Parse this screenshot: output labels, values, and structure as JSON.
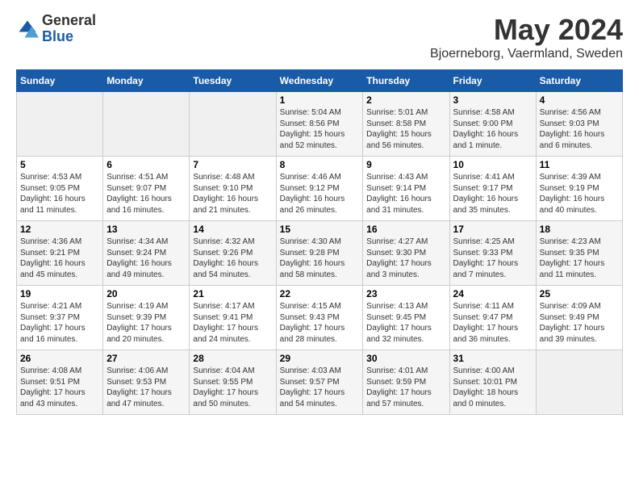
{
  "header": {
    "logo_general": "General",
    "logo_blue": "Blue",
    "title": "May 2024",
    "location": "Bjoerneborg, Vaermland, Sweden"
  },
  "weekdays": [
    "Sunday",
    "Monday",
    "Tuesday",
    "Wednesday",
    "Thursday",
    "Friday",
    "Saturday"
  ],
  "weeks": [
    [
      {
        "day": "",
        "info": ""
      },
      {
        "day": "",
        "info": ""
      },
      {
        "day": "",
        "info": ""
      },
      {
        "day": "1",
        "info": "Sunrise: 5:04 AM\nSunset: 8:56 PM\nDaylight: 15 hours and 52 minutes."
      },
      {
        "day": "2",
        "info": "Sunrise: 5:01 AM\nSunset: 8:58 PM\nDaylight: 15 hours and 56 minutes."
      },
      {
        "day": "3",
        "info": "Sunrise: 4:58 AM\nSunset: 9:00 PM\nDaylight: 16 hours and 1 minute."
      },
      {
        "day": "4",
        "info": "Sunrise: 4:56 AM\nSunset: 9:03 PM\nDaylight: 16 hours and 6 minutes."
      }
    ],
    [
      {
        "day": "5",
        "info": "Sunrise: 4:53 AM\nSunset: 9:05 PM\nDaylight: 16 hours and 11 minutes."
      },
      {
        "day": "6",
        "info": "Sunrise: 4:51 AM\nSunset: 9:07 PM\nDaylight: 16 hours and 16 minutes."
      },
      {
        "day": "7",
        "info": "Sunrise: 4:48 AM\nSunset: 9:10 PM\nDaylight: 16 hours and 21 minutes."
      },
      {
        "day": "8",
        "info": "Sunrise: 4:46 AM\nSunset: 9:12 PM\nDaylight: 16 hours and 26 minutes."
      },
      {
        "day": "9",
        "info": "Sunrise: 4:43 AM\nSunset: 9:14 PM\nDaylight: 16 hours and 31 minutes."
      },
      {
        "day": "10",
        "info": "Sunrise: 4:41 AM\nSunset: 9:17 PM\nDaylight: 16 hours and 35 minutes."
      },
      {
        "day": "11",
        "info": "Sunrise: 4:39 AM\nSunset: 9:19 PM\nDaylight: 16 hours and 40 minutes."
      }
    ],
    [
      {
        "day": "12",
        "info": "Sunrise: 4:36 AM\nSunset: 9:21 PM\nDaylight: 16 hours and 45 minutes."
      },
      {
        "day": "13",
        "info": "Sunrise: 4:34 AM\nSunset: 9:24 PM\nDaylight: 16 hours and 49 minutes."
      },
      {
        "day": "14",
        "info": "Sunrise: 4:32 AM\nSunset: 9:26 PM\nDaylight: 16 hours and 54 minutes."
      },
      {
        "day": "15",
        "info": "Sunrise: 4:30 AM\nSunset: 9:28 PM\nDaylight: 16 hours and 58 minutes."
      },
      {
        "day": "16",
        "info": "Sunrise: 4:27 AM\nSunset: 9:30 PM\nDaylight: 17 hours and 3 minutes."
      },
      {
        "day": "17",
        "info": "Sunrise: 4:25 AM\nSunset: 9:33 PM\nDaylight: 17 hours and 7 minutes."
      },
      {
        "day": "18",
        "info": "Sunrise: 4:23 AM\nSunset: 9:35 PM\nDaylight: 17 hours and 11 minutes."
      }
    ],
    [
      {
        "day": "19",
        "info": "Sunrise: 4:21 AM\nSunset: 9:37 PM\nDaylight: 17 hours and 16 minutes."
      },
      {
        "day": "20",
        "info": "Sunrise: 4:19 AM\nSunset: 9:39 PM\nDaylight: 17 hours and 20 minutes."
      },
      {
        "day": "21",
        "info": "Sunrise: 4:17 AM\nSunset: 9:41 PM\nDaylight: 17 hours and 24 minutes."
      },
      {
        "day": "22",
        "info": "Sunrise: 4:15 AM\nSunset: 9:43 PM\nDaylight: 17 hours and 28 minutes."
      },
      {
        "day": "23",
        "info": "Sunrise: 4:13 AM\nSunset: 9:45 PM\nDaylight: 17 hours and 32 minutes."
      },
      {
        "day": "24",
        "info": "Sunrise: 4:11 AM\nSunset: 9:47 PM\nDaylight: 17 hours and 36 minutes."
      },
      {
        "day": "25",
        "info": "Sunrise: 4:09 AM\nSunset: 9:49 PM\nDaylight: 17 hours and 39 minutes."
      }
    ],
    [
      {
        "day": "26",
        "info": "Sunrise: 4:08 AM\nSunset: 9:51 PM\nDaylight: 17 hours and 43 minutes."
      },
      {
        "day": "27",
        "info": "Sunrise: 4:06 AM\nSunset: 9:53 PM\nDaylight: 17 hours and 47 minutes."
      },
      {
        "day": "28",
        "info": "Sunrise: 4:04 AM\nSunset: 9:55 PM\nDaylight: 17 hours and 50 minutes."
      },
      {
        "day": "29",
        "info": "Sunrise: 4:03 AM\nSunset: 9:57 PM\nDaylight: 17 hours and 54 minutes."
      },
      {
        "day": "30",
        "info": "Sunrise: 4:01 AM\nSunset: 9:59 PM\nDaylight: 17 hours and 57 minutes."
      },
      {
        "day": "31",
        "info": "Sunrise: 4:00 AM\nSunset: 10:01 PM\nDaylight: 18 hours and 0 minutes."
      },
      {
        "day": "",
        "info": ""
      }
    ]
  ]
}
